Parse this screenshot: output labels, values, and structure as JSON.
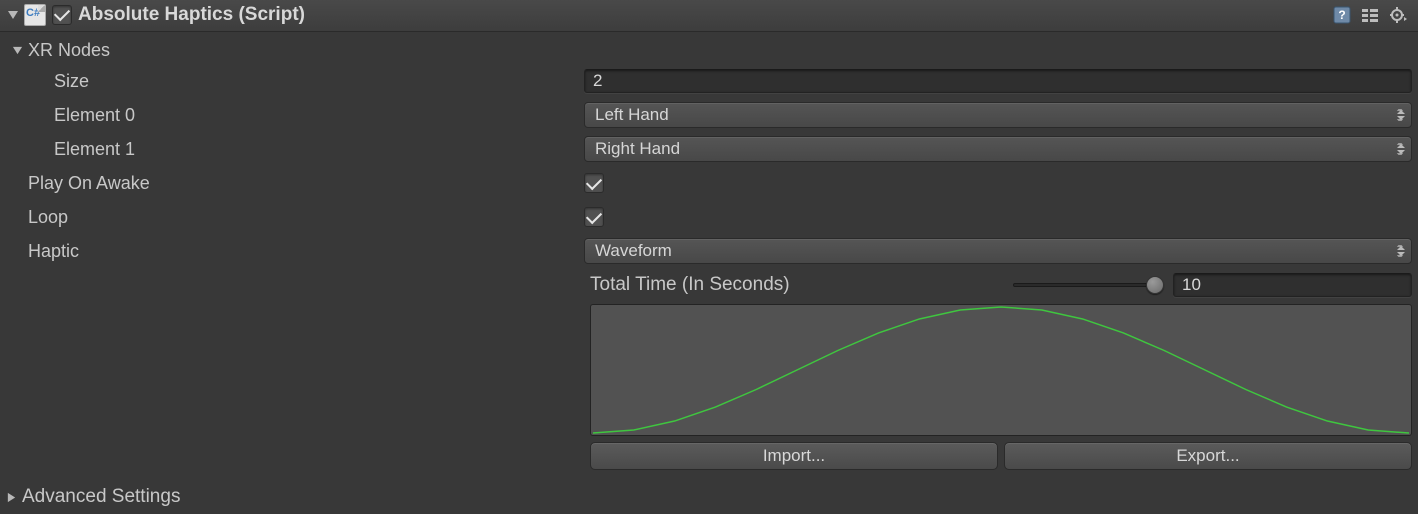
{
  "header": {
    "title": "Absolute Haptics (Script)",
    "enabled": true,
    "icons": {
      "help": "help-icon",
      "preset": "preset-icon",
      "gear": "gear-icon"
    }
  },
  "xrNodes": {
    "label": "XR Nodes",
    "sizeLabel": "Size",
    "size": "2",
    "elements": [
      {
        "label": "Element 0",
        "value": "Left Hand"
      },
      {
        "label": "Element 1",
        "value": "Right Hand"
      }
    ]
  },
  "playOnAwake": {
    "label": "Play On Awake",
    "value": true
  },
  "loop": {
    "label": "Loop",
    "value": true
  },
  "haptic": {
    "label": "Haptic",
    "mode": "Waveform",
    "totalTimeLabel": "Total Time (In Seconds)",
    "totalTime": "10",
    "sliderPos": 1.0,
    "importLabel": "Import...",
    "exportLabel": "Export..."
  },
  "advanced": {
    "label": "Advanced Settings"
  },
  "chart_data": {
    "type": "line",
    "title": "",
    "x": [
      0.0,
      0.05,
      0.1,
      0.15,
      0.2,
      0.25,
      0.3,
      0.35,
      0.4,
      0.45,
      0.5,
      0.55,
      0.6,
      0.65,
      0.7,
      0.75,
      0.8,
      0.85,
      0.9,
      0.95,
      1.0
    ],
    "values": [
      0.0,
      0.024,
      0.095,
      0.206,
      0.345,
      0.5,
      0.655,
      0.794,
      0.905,
      0.976,
      1.0,
      0.976,
      0.905,
      0.794,
      0.655,
      0.5,
      0.345,
      0.206,
      0.095,
      0.024,
      0.0
    ],
    "xlabel": "",
    "ylabel": "",
    "xlim": [
      0,
      1
    ],
    "ylim": [
      0,
      1
    ],
    "color": "#3fc63f"
  }
}
